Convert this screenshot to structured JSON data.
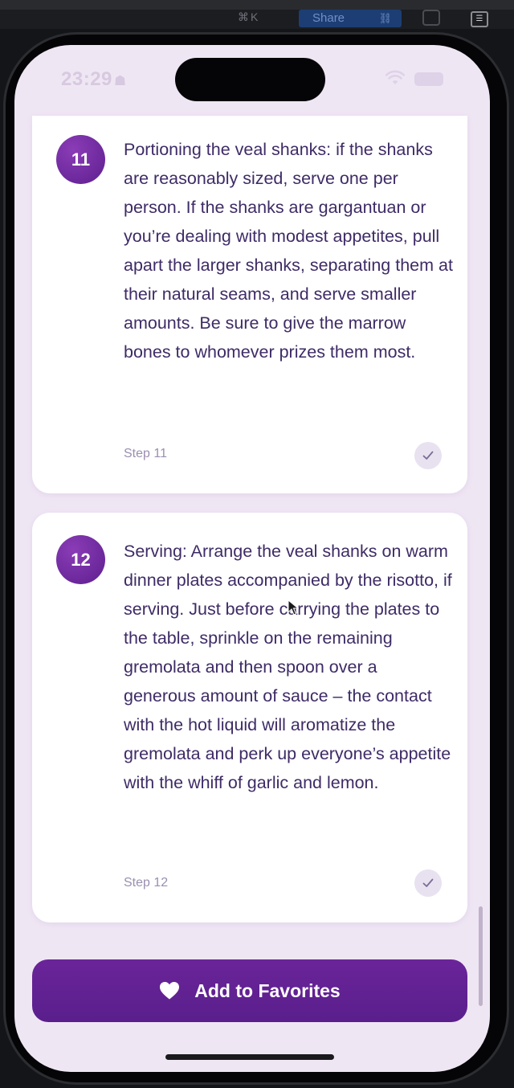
{
  "host": {
    "shortcut": "⌘K",
    "share_label": "Share"
  },
  "status_bar": {
    "time": "23:29"
  },
  "steps": [
    {
      "number": "11",
      "text": "Portioning the veal shanks: if the shanks are reasonably sized, serve one per person. If the shanks are gargantuan or you’re dealing with modest appetites, pull apart the larger shanks, separating them at their natural seams, and serve smaller amounts. Be sure to give the marrow bones to whomever prizes them most.",
      "label": "Step 11",
      "done": false
    },
    {
      "number": "12",
      "text": "Serving: Arrange the veal shanks on warm dinner plates accompanied by the risotto, if serving. Just before carrying the plates to the table, sprinkle on the remaining gremolata and then spoon over a generous amount of sauce – the contact with the hot liquid will aromatize the gremolata and perk up everyone’s appetite with the whiff of garlic and lemon.",
      "label": "Step 12",
      "done": false
    }
  ],
  "favorites_button": {
    "label": "Add to Favorites",
    "icon": "heart-icon"
  },
  "colors": {
    "accent": "#5e1f8f",
    "background": "#efe6f4",
    "text": "#3e2b66"
  }
}
